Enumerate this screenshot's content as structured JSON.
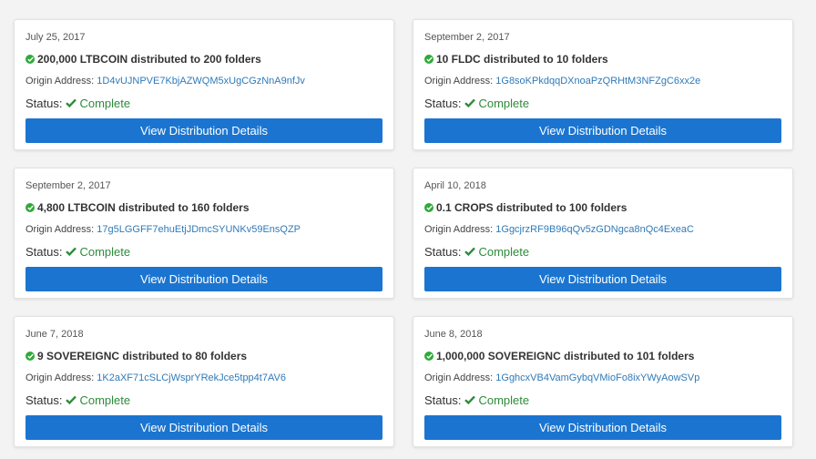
{
  "colors": {
    "accent": "#1b75d0",
    "success": "#2eaa3a",
    "link": "#2f7ab8"
  },
  "labels": {
    "origin_prefix": "Origin Address:",
    "status_prefix": "Status:",
    "button": "View Distribution Details"
  },
  "cards": [
    {
      "date": "July 25, 2017",
      "summary": "200,000 LTBCOIN distributed to 200 folders",
      "address": "1D4vUJNPVE7KbjAZWQM5xUgCGzNnA9nfJv",
      "status": "Complete"
    },
    {
      "date": "September 2, 2017",
      "summary": "10 FLDC distributed to 10 folders",
      "address": "1G8soKPkdqqDXnoaPzQRHtM3NFZgC6xx2e",
      "status": "Complete"
    },
    {
      "date": "September 2, 2017",
      "summary": "4,800 LTBCOIN distributed to 160 folders",
      "address": "17g5LGGFF7ehuEtjJDmcSYUNKv59EnsQZP",
      "status": "Complete"
    },
    {
      "date": "April 10, 2018",
      "summary": "0.1 CROPS distributed to 100 folders",
      "address": "1GgcjrzRF9B96qQv5zGDNgca8nQc4ExeaC",
      "status": "Complete"
    },
    {
      "date": "June 7, 2018",
      "summary": "9 SOVEREIGNC distributed to 80 folders",
      "address": "1K2aXF71cSLCjWsprYRekJce5tpp4t7AV6",
      "status": "Complete"
    },
    {
      "date": "June 8, 2018",
      "summary": "1,000,000 SOVEREIGNC distributed to 101 folders",
      "address": "1GghcxVB4VamGybqVMioFo8ixYWyAowSVp",
      "status": "Complete"
    }
  ]
}
